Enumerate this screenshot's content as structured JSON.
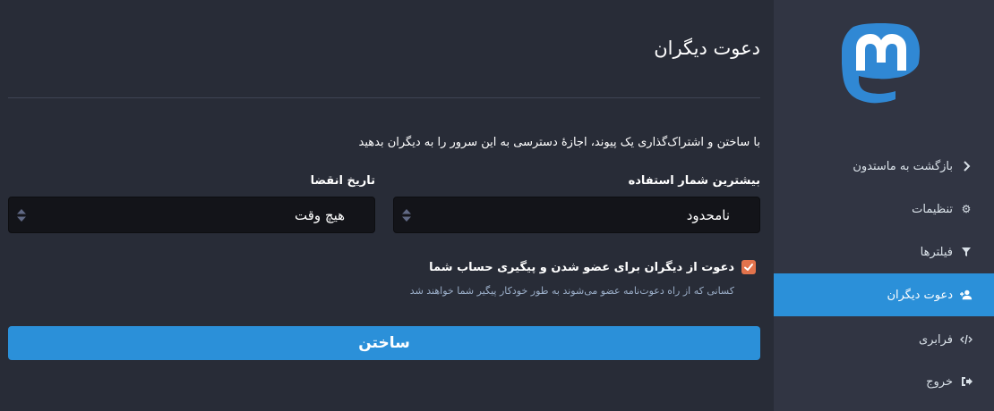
{
  "main": {
    "title": "دعوت دیگران",
    "hint": "با ساختن و اشتراک‌گذاری یک پیوند، اجازهٔ دسترسی به این سرور را به دیگران بدهید",
    "max_uses": {
      "label": "بیشترین شمار استفاده",
      "value": "نامحدود"
    },
    "expires": {
      "label": "تاریخ انقضا",
      "value": "هیچ وقت"
    },
    "autofollow": {
      "label": "دعوت از دیگران برای عضو شدن و پیگیری حساب شما",
      "hint": "کسانی که از راه دعوت‌نامه عضو می‌شوند به طور خودکار پیگیر شما خواهند شد",
      "checked": true
    },
    "submit_label": "ساختن"
  },
  "sidebar": {
    "logo_icon": "mastodon-logo-icon",
    "items": [
      {
        "label": "بازگشت به ماستدون",
        "icon": "chevron-right-icon",
        "active": false
      },
      {
        "label": "تنظیمات",
        "icon": "gear-icon",
        "active": false
      },
      {
        "label": "فیلترها",
        "icon": "filter-icon",
        "active": false
      },
      {
        "label": "دعوت دیگران",
        "icon": "user-plus-icon",
        "active": true
      },
      {
        "label": "فرابری",
        "icon": "code-icon",
        "active": false
      },
      {
        "label": "خروج",
        "icon": "sign-out-icon",
        "active": false
      }
    ]
  },
  "colors": {
    "accent": "#2b90d9",
    "checkbox": "#e2734c",
    "main_bg": "#282c37",
    "sidebar_bg": "#313543"
  }
}
